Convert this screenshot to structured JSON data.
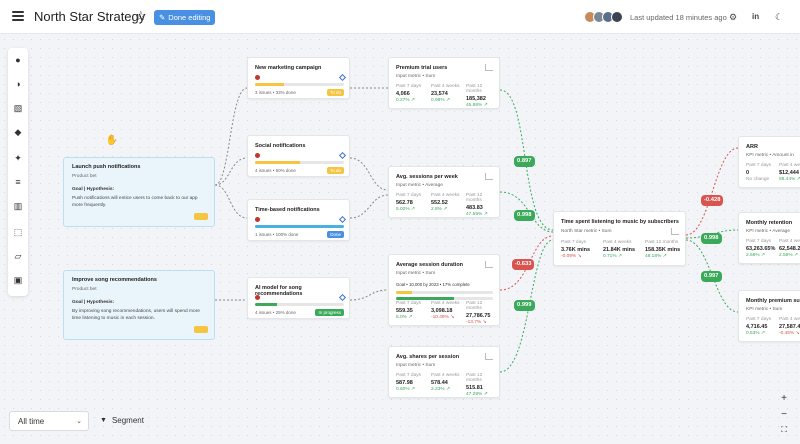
{
  "header": {
    "title": "North Star Strategy",
    "done_label": "Done editing",
    "updated": "Last updated 18 minutes ago",
    "avatar_count": 4
  },
  "goals": [
    {
      "title": "Launch push notifications",
      "subtitle": "Product bet",
      "goal_label": "Goal | Hypothesis:",
      "desc": "Push notifications will entice users to come back to our app more frequently."
    },
    {
      "title": "Improve song recommendations",
      "subtitle": "Product bet",
      "goal_label": "Goal | Hypothesis:",
      "desc": "By improving song recommendations, users will spend more time listening to music in each session."
    }
  ],
  "initiatives": [
    {
      "title": "New marketing campaign",
      "meta": "3 issues  •  33% done",
      "progress": 0.33,
      "bar_color": "#f5c542",
      "tag": "To do",
      "tag_color": "#f5c542"
    },
    {
      "title": "Social notifications",
      "meta": "4 issues  •  50% done",
      "progress": 0.5,
      "bar_color": "#f5c542",
      "tag": "To do",
      "tag_color": "#f5c542"
    },
    {
      "title": "Time-based notifications",
      "meta": "1 issues  •  100% done",
      "progress": 1.0,
      "bar_color": "#4ab0e0",
      "tag": "Done",
      "tag_color": "#4a90e2"
    },
    {
      "title": "AI model for song recommendations",
      "meta": "4 issues  •  25% done",
      "progress": 0.25,
      "bar_color": "#3aa95a",
      "tag": "In progress",
      "tag_color": "#3aa95a"
    }
  ],
  "metrics": [
    {
      "title": "Premium trial users",
      "sub": "Input metric  •  Sum",
      "cols": [
        {
          "lbl": "Past 7 days",
          "val": "4,066",
          "pct": "0.27% ↗",
          "cls": "green"
        },
        {
          "lbl": "Past 4 weeks",
          "val": "23,574",
          "pct": "0.98% ↗",
          "cls": "green"
        },
        {
          "lbl": "Past 12 months",
          "val": "185,382",
          "pct": "45.88% ↗",
          "cls": "green"
        }
      ]
    },
    {
      "title": "Avg. sessions per week",
      "sub": "Input metric  •  Average",
      "cols": [
        {
          "lbl": "Past 7 days",
          "val": "562.78",
          "pct": "5.02% ↗",
          "cls": "green"
        },
        {
          "lbl": "Past 4 weeks",
          "val": "552.52",
          "pct": "2.8% ↗",
          "cls": "green"
        },
        {
          "lbl": "Past 12 months",
          "val": "483.83",
          "pct": "47.59% ↗",
          "cls": "green"
        }
      ]
    },
    {
      "title": "Average session duration",
      "sub": "Input metric  •  Sum",
      "goal": "Goal  •  10,000 by 2023  •  17% complete",
      "cols": [
        {
          "lbl": "Past 7 days",
          "val": "559.35",
          "pct": "6.0% ↗",
          "cls": "green"
        },
        {
          "lbl": "Past 4 weeks",
          "val": "3,098.18",
          "pct": "-10.49% ↘",
          "cls": "red"
        },
        {
          "lbl": "Past 12 months",
          "val": "27,786.75",
          "pct": "-13.7% ↘",
          "cls": "red"
        }
      ]
    },
    {
      "title": "Avg. shares per session",
      "sub": "Input metric  •  Sum",
      "cols": [
        {
          "lbl": "Past 7 days",
          "val": "587.98",
          "pct": "0.60% ↗",
          "cls": "green"
        },
        {
          "lbl": "Past 4 weeks",
          "val": "578.44",
          "pct": "2.23% ↗",
          "cls": "green"
        },
        {
          "lbl": "Past 12 months",
          "val": "515.81",
          "pct": "47.29% ↗",
          "cls": "green"
        }
      ]
    }
  ],
  "north_star": {
    "title": "Time spent listening to music by subscribers",
    "sub": "North Star metric  •  Sum",
    "cols": [
      {
        "lbl": "Past 7 days",
        "val": "3.76K mins",
        "pct": "-0.09% ↘",
        "cls": "red"
      },
      {
        "lbl": "Past 4 weeks",
        "val": "21.84K mins",
        "pct": "0.71% ↗",
        "cls": "green"
      },
      {
        "lbl": "Past 12 months",
        "val": "158.35K mins",
        "pct": "48.18% ↗",
        "cls": "green"
      }
    ]
  },
  "kpis": [
    {
      "title": "ARR",
      "sub": "KPI metric  •  Amount in",
      "cols": [
        {
          "lbl": "Past 7 days",
          "val": "0",
          "pct": "No change",
          "cls": "grey"
        },
        {
          "lbl": "Past 4 weeks",
          "val": "$12,444",
          "pct": "58.44% ↗",
          "cls": "green"
        }
      ]
    },
    {
      "title": "Monthly retention",
      "sub": "KPI metric  •  Average",
      "cols": [
        {
          "lbl": "Past 7 days",
          "val": "63,263.65%",
          "pct": "2.56% ↗",
          "cls": "green"
        },
        {
          "lbl": "Past 4 weeks",
          "val": "62,548.2",
          "pct": "2.56% ↗",
          "cls": "green"
        }
      ]
    },
    {
      "title": "Monthly premium su",
      "sub": "KPI metric  •  Sum",
      "cols": [
        {
          "lbl": "Past 7 days",
          "val": "4,716.45",
          "pct": "0.53% ↗",
          "cls": "green"
        },
        {
          "lbl": "Past 4 weeks",
          "val": "27,587.46",
          "pct": "-0.45% ↘",
          "cls": "red"
        }
      ]
    }
  ],
  "correlations": [
    "0.897",
    "0.998",
    "-0.633",
    "0.999",
    "-0.428",
    "0.998",
    "0.997"
  ],
  "footer": {
    "timeframe": "All time",
    "segment": "Segment"
  }
}
